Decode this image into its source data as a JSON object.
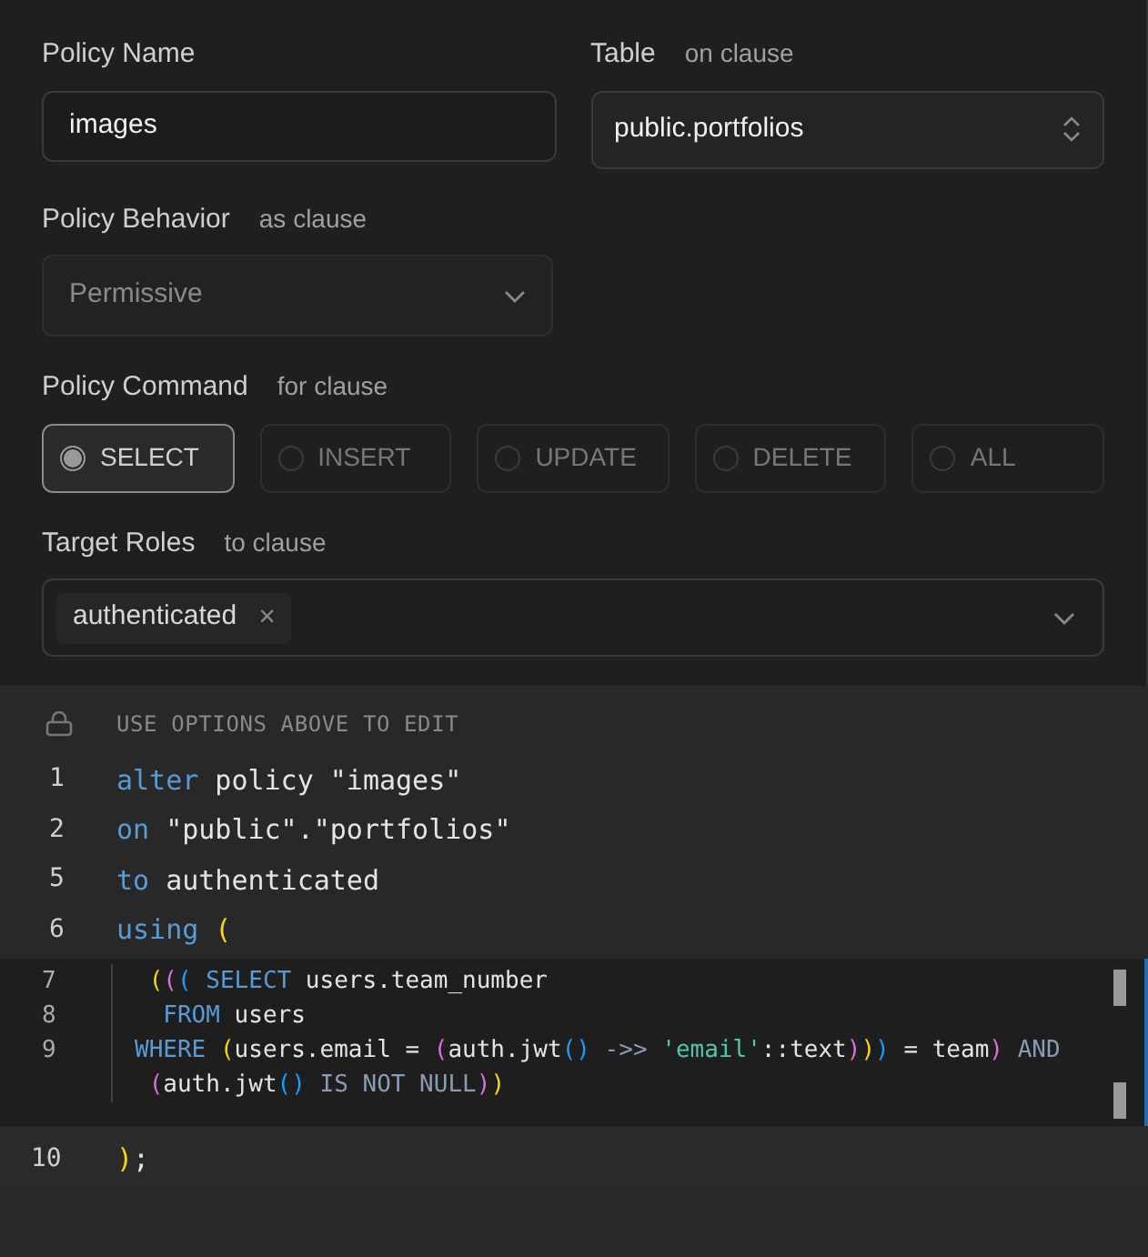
{
  "policy_name": {
    "label": "Policy Name",
    "value": "images"
  },
  "table": {
    "label": "Table",
    "hint": "on clause",
    "value": "public.portfolios"
  },
  "behavior": {
    "label": "Policy Behavior",
    "hint": "as clause",
    "value": "Permissive",
    "disabled": true
  },
  "command": {
    "label": "Policy Command",
    "hint": "for clause",
    "options": [
      {
        "label": "SELECT",
        "selected": true
      },
      {
        "label": "INSERT",
        "selected": false
      },
      {
        "label": "UPDATE",
        "selected": false
      },
      {
        "label": "DELETE",
        "selected": false
      },
      {
        "label": "ALL",
        "selected": false
      }
    ]
  },
  "roles": {
    "label": "Target Roles",
    "hint": "to clause",
    "tags": [
      "authenticated"
    ],
    "remove_icon": "×"
  },
  "editor": {
    "notice": "USE OPTIONS ABOVE TO EDIT",
    "lines": [
      {
        "number": "1",
        "tokens": [
          {
            "kind": "keyword",
            "text": "alter"
          },
          {
            "kind": "plain",
            "text": " policy \"images\""
          }
        ]
      },
      {
        "number": "2",
        "tokens": [
          {
            "kind": "keyword",
            "text": "on"
          },
          {
            "kind": "plain",
            "text": " \"public\".\"portfolios\""
          }
        ]
      },
      {
        "number": "5",
        "tokens": [
          {
            "kind": "keyword",
            "text": "to"
          },
          {
            "kind": "plain",
            "text": " authenticated"
          }
        ]
      },
      {
        "number": "6",
        "tokens": [
          {
            "kind": "keyword",
            "text": "using"
          },
          {
            "kind": "paren1",
            "text": " ("
          }
        ]
      }
    ],
    "embedded_lines": [
      {
        "number": "7",
        "tokens": [
          {
            "kind": "paren1",
            "text": " ("
          },
          {
            "kind": "paren2",
            "text": "("
          },
          {
            "kind": "paren3",
            "text": "("
          },
          {
            "kind": "keyword",
            "text": " SELECT"
          },
          {
            "kind": "plain",
            "text": " users.team_number"
          }
        ]
      },
      {
        "number": "8",
        "tokens": [
          {
            "kind": "keyword",
            "text": "  FROM"
          },
          {
            "kind": "plain",
            "text": " users"
          }
        ]
      },
      {
        "number": "9",
        "tokens": [
          {
            "kind": "keyword",
            "text": "WHERE"
          },
          {
            "kind": "paren1",
            "text": " ("
          },
          {
            "kind": "plain",
            "text": "users.email = "
          },
          {
            "kind": "paren2",
            "text": "("
          },
          {
            "kind": "plain",
            "text": "auth.jwt"
          },
          {
            "kind": "paren3",
            "text": "()"
          },
          {
            "kind": "operator",
            "text": " ->> "
          },
          {
            "kind": "string",
            "text": "'email'"
          },
          {
            "kind": "plain",
            "text": "::text"
          },
          {
            "kind": "paren2",
            "text": ")"
          },
          {
            "kind": "paren1",
            "text": ")"
          },
          {
            "kind": "paren3",
            "text": ")"
          },
          {
            "kind": "plain",
            "text": " = team"
          },
          {
            "kind": "paren2",
            "text": ")"
          },
          {
            "kind": "operator",
            "text": " AND"
          }
        ]
      },
      {
        "tokens": [
          {
            "kind": "paren2",
            "text": " ("
          },
          {
            "kind": "plain",
            "text": "auth.jwt"
          },
          {
            "kind": "paren3",
            "text": "()"
          },
          {
            "kind": "operator",
            "text": " IS NOT NULL"
          },
          {
            "kind": "paren2",
            "text": ")"
          },
          {
            "kind": "paren1",
            "text": ")"
          }
        ]
      }
    ],
    "closing_line": {
      "number": "10",
      "tokens": [
        {
          "kind": "paren1",
          "text": ")"
        },
        {
          "kind": "plain",
          "text": ";"
        }
      ]
    }
  }
}
